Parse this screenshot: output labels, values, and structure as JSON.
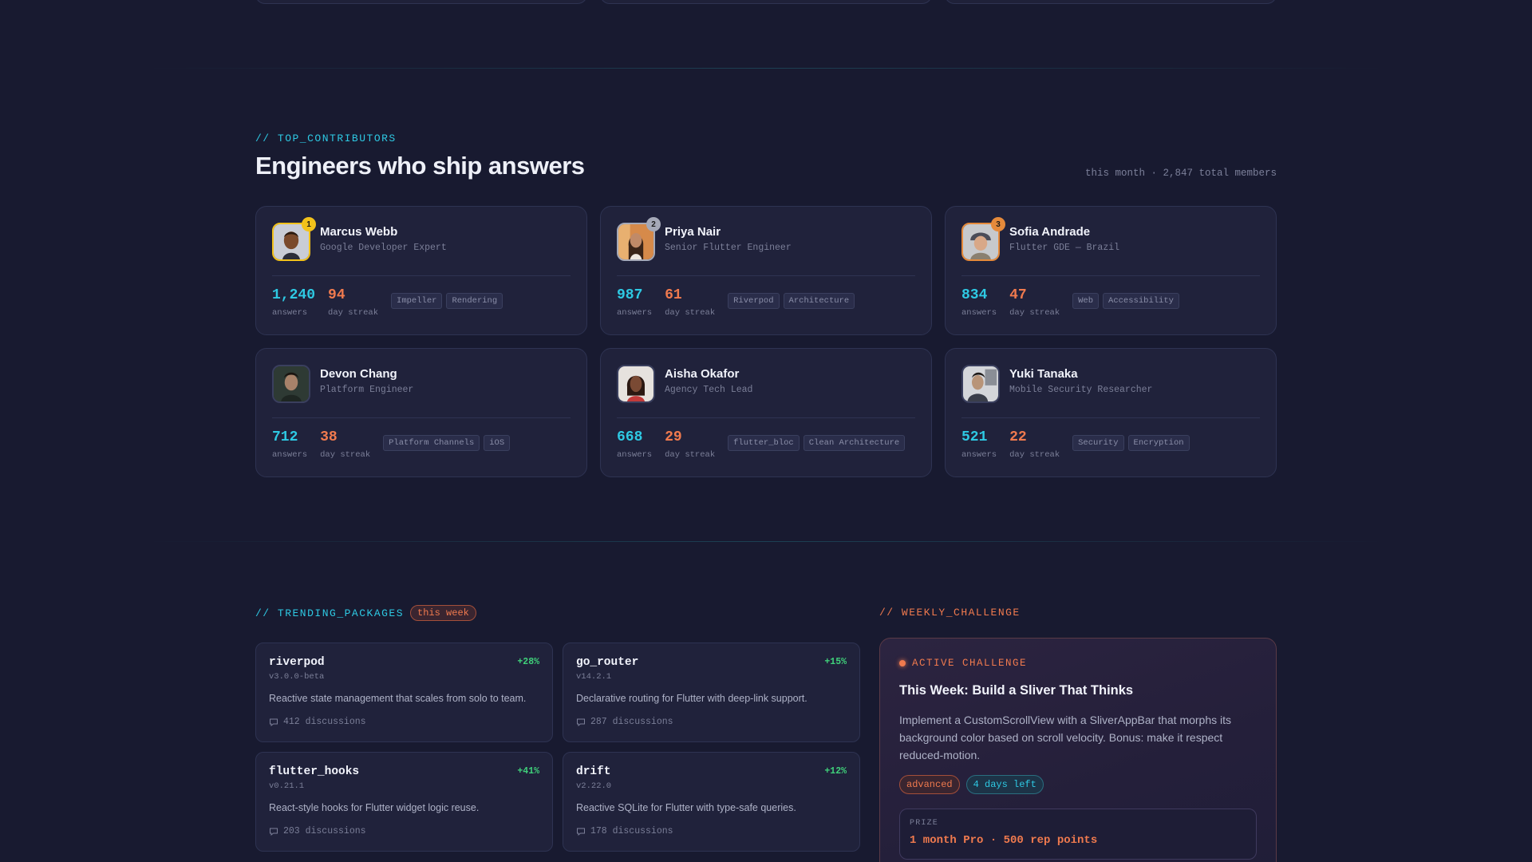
{
  "contributors_section": {
    "kicker": "// TOP_CONTRIBUTORS",
    "title": "Engineers who ship answers",
    "meta": "this month · 2,847 total members",
    "cards": [
      {
        "name": "Marcus Webb",
        "role": "Google Developer Expert",
        "rank": "1",
        "answers": "1,240",
        "streak": "94",
        "answers_label": "answers",
        "streak_label": "day streak",
        "tags": [
          "Impeller",
          "Rendering"
        ]
      },
      {
        "name": "Priya Nair",
        "role": "Senior Flutter Engineer",
        "rank": "2",
        "answers": "987",
        "streak": "61",
        "answers_label": "answers",
        "streak_label": "day streak",
        "tags": [
          "Riverpod",
          "Architecture"
        ]
      },
      {
        "name": "Sofia Andrade",
        "role": "Flutter GDE — Brazil",
        "rank": "3",
        "answers": "834",
        "streak": "47",
        "answers_label": "answers",
        "streak_label": "day streak",
        "tags": [
          "Web",
          "Accessibility"
        ]
      },
      {
        "name": "Devon Chang",
        "role": "Platform Engineer",
        "rank": "",
        "answers": "712",
        "streak": "38",
        "answers_label": "answers",
        "streak_label": "day streak",
        "tags": [
          "Platform Channels",
          "iOS"
        ]
      },
      {
        "name": "Aisha Okafor",
        "role": "Agency Tech Lead",
        "rank": "",
        "answers": "668",
        "streak": "29",
        "answers_label": "answers",
        "streak_label": "day streak",
        "tags": [
          "flutter_bloc",
          "Clean Architecture"
        ]
      },
      {
        "name": "Yuki Tanaka",
        "role": "Mobile Security Researcher",
        "rank": "",
        "answers": "521",
        "streak": "22",
        "answers_label": "answers",
        "streak_label": "day streak",
        "tags": [
          "Security",
          "Encryption"
        ]
      }
    ]
  },
  "trending": {
    "kicker": "// TRENDING_PACKAGES",
    "badge": "this week",
    "packages": [
      {
        "name": "riverpod",
        "version": "v3.0.0-beta",
        "trend": "+28%",
        "description": "Reactive state management that scales from solo to team.",
        "discussions": "412 discussions"
      },
      {
        "name": "go_router",
        "version": "v14.2.1",
        "trend": "+15%",
        "description": "Declarative routing for Flutter with deep-link support.",
        "discussions": "287 discussions"
      },
      {
        "name": "flutter_hooks",
        "version": "v0.21.1",
        "trend": "+41%",
        "description": "React-style hooks for Flutter widget logic reuse.",
        "discussions": "203 discussions"
      },
      {
        "name": "drift",
        "version": "v2.22.0",
        "trend": "+12%",
        "description": "Reactive SQLite for Flutter with type-safe queries.",
        "discussions": "178 discussions"
      }
    ]
  },
  "challenge": {
    "kicker": "// WEEKLY_CHALLENGE",
    "status": "ACTIVE CHALLENGE",
    "title": "This Week: Build a Sliver That Thinks",
    "description": "Implement a CustomScrollView with a SliverAppBar that morphs its background color based on scroll velocity. Bonus: make it respect reduced-motion.",
    "level": "advanced",
    "time_left": "4 days left",
    "prize_label": "PRIZE",
    "prize": "1 month Pro · 500 rep points"
  },
  "colors": {
    "accent_cyan": "#2ec9e3",
    "accent_orange": "#f07a4e",
    "trend_green": "#3fd07a",
    "background": "#181a30"
  }
}
